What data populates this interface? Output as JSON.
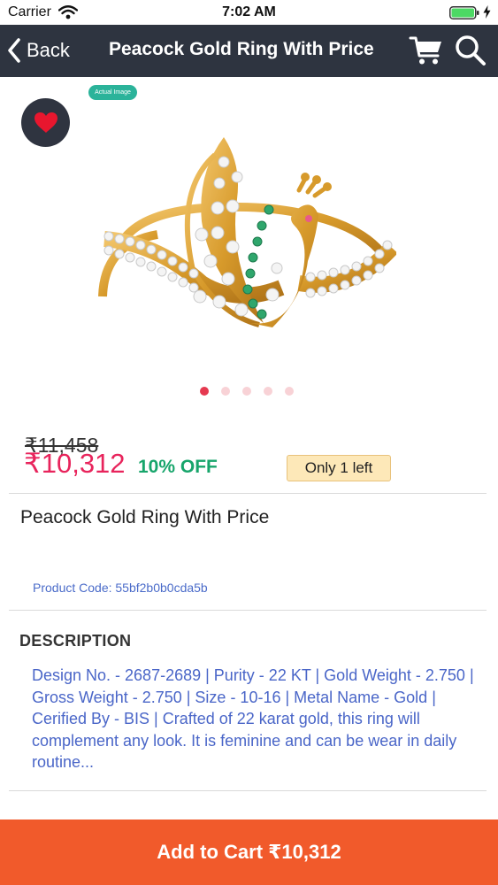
{
  "status_bar": {
    "carrier": "Carrier",
    "time": "7:02 AM",
    "icons": [
      "wifi-icon",
      "battery-icon",
      "charging-bolt-icon"
    ]
  },
  "nav": {
    "back_label": "Back",
    "title": "Peacock Gold Ring With Price",
    "icons": [
      "chevron-left-icon",
      "cart-icon",
      "search-icon"
    ]
  },
  "gallery": {
    "badge": "Actual Image",
    "image_count": 5,
    "active_index": 0,
    "icons": [
      "heart-icon"
    ],
    "colors": {
      "heart": "#e8162e",
      "dot_active": "#e53950",
      "dot_inactive": "#f8d2d6"
    }
  },
  "pricing": {
    "original_price": "₹11,458",
    "sale_price": "₹10,312",
    "discount": "10% OFF",
    "stock": "Only 1 left",
    "colors": {
      "sale": "#e8245c",
      "discount": "#17a56b"
    }
  },
  "product": {
    "name": "Peacock Gold Ring With Price",
    "code": "Product Code: 55bf2b0b0cda5b"
  },
  "description": {
    "heading": "DESCRIPTION",
    "text": "Design No. - 2687-2689 | Purity - 22 KT | Gold Weight - 2.750 | Gross Weight - 2.750 | Size - 10-16 | Metal Name - Gold | Cerified By - BIS | Crafted of 22 karat gold, this ring will complement any look. It is feminine and can be wear in daily routine..."
  },
  "footer": {
    "add_to_cart": "Add to Cart ₹10,312",
    "color": "#f15a2b"
  }
}
